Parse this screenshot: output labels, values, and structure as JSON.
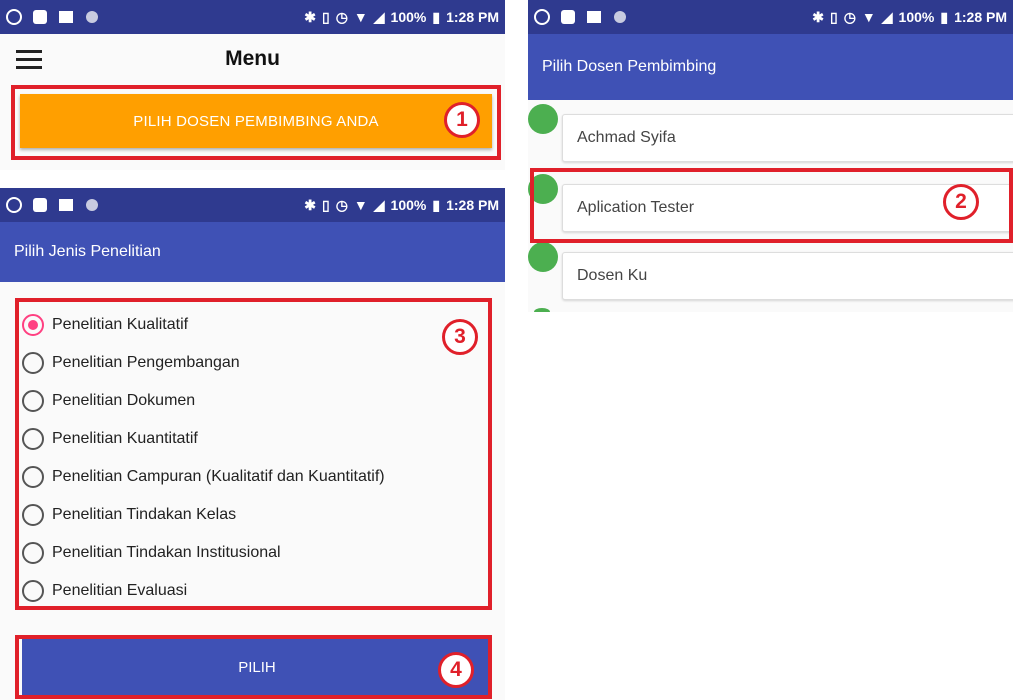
{
  "status_bar": {
    "battery": "100%",
    "time": "1:28 PM"
  },
  "menu_screen": {
    "title": "Menu",
    "pick_supervisor_button": "PILIH DOSEN PEMBIMBING ANDA"
  },
  "research_screen": {
    "title": "Pilih Jenis Penelitian",
    "options": [
      {
        "label": "Penelitian Kualitatif",
        "checked": true
      },
      {
        "label": "Penelitian Pengembangan",
        "checked": false
      },
      {
        "label": "Penelitian Dokumen",
        "checked": false
      },
      {
        "label": "Penelitian Kuantitatif",
        "checked": false
      },
      {
        "label": "Penelitian Campuran (Kualitatif dan Kuantitatif)",
        "checked": false
      },
      {
        "label": "Penelitian Tindakan Kelas",
        "checked": false
      },
      {
        "label": "Penelitian Tindakan Institusional",
        "checked": false
      },
      {
        "label": "Penelitian Evaluasi",
        "checked": false
      }
    ],
    "submit_button": "PILIH"
  },
  "supervisor_screen": {
    "title": "Pilih Dosen Pembimbing",
    "lecturers": [
      "Achmad Syifa",
      "Aplication Tester",
      "Dosen Ku"
    ]
  },
  "annotations": [
    "1",
    "2",
    "3",
    "4"
  ],
  "colors": {
    "primary": "#3f51b5",
    "status": "#2f3a8f",
    "accent": "#ff9f00",
    "radio": "#ff4081",
    "dot": "#4caf50",
    "annotation": "#e0202a"
  }
}
